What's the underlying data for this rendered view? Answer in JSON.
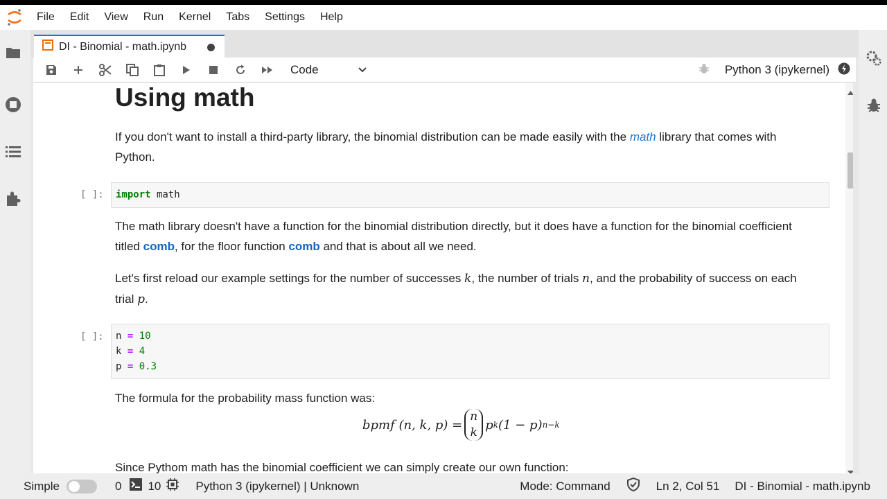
{
  "menubar": {
    "items": [
      "File",
      "Edit",
      "View",
      "Run",
      "Kernel",
      "Tabs",
      "Settings",
      "Help"
    ]
  },
  "tab": {
    "title": "DI - Binomial - math.ipynb"
  },
  "toolbar": {
    "cell_type": "Code",
    "kernel": "Python 3 (ipykernel)"
  },
  "notebook": {
    "heading": "Using math",
    "para1_a": "If you don't want to install a third-party library, the binomial distribution can be made easily with the ",
    "para1_link": "math",
    "para1_b": " library that comes with Python.",
    "cell1_prompt": "[ ]:",
    "cell1_kw": "import",
    "cell1_rest": " math",
    "para2_a": "The math library doesn't have a function for the binomial distribution directly, but it does have a function for the binomial coefficient titled ",
    "para2_comb1": "comb",
    "para2_b": ", for the floor function ",
    "para2_comb2": "comb",
    "para2_c": " and that is about all we need.",
    "para3_a": "Let's first reload our example settings for the number of successes ",
    "var_k": "k",
    "para3_b": ", the number of trials ",
    "var_n": "n",
    "para3_c": ", and the probability of success on each trial ",
    "var_p": "p",
    "para3_d": ".",
    "cell2_prompt": "[ ]:",
    "cell2_lines": [
      {
        "var": "n",
        "op": "=",
        "val": "10"
      },
      {
        "var": "k",
        "op": "=",
        "val": "4"
      },
      {
        "var": "p",
        "op": "=",
        "val": "0.3"
      }
    ],
    "para4": "The formula for the probability mass function was:",
    "formula": {
      "lhs": "bpmf (n, k, p) =",
      "binom_top": "n",
      "binom_bottom": "k",
      "p1": "p",
      "exp1": "k",
      "mid": "(1 − p)",
      "exp2": "n−k"
    },
    "para5": "Since Pythom math has the binomial coefficient we can simply create our own function:"
  },
  "statusbar": {
    "mode_label": "Simple",
    "terminals": "0",
    "kernels": "10",
    "kernel_status": "Python 3 (ipykernel) | Unknown",
    "mode": "Mode: Command",
    "position": "Ln 2, Col 51",
    "filename": "DI - Binomial - math.ipynb"
  },
  "colors": {
    "accent": "#1976d2",
    "link": "#1976d2",
    "keyword": "#008000",
    "operator": "#aa22ff"
  }
}
